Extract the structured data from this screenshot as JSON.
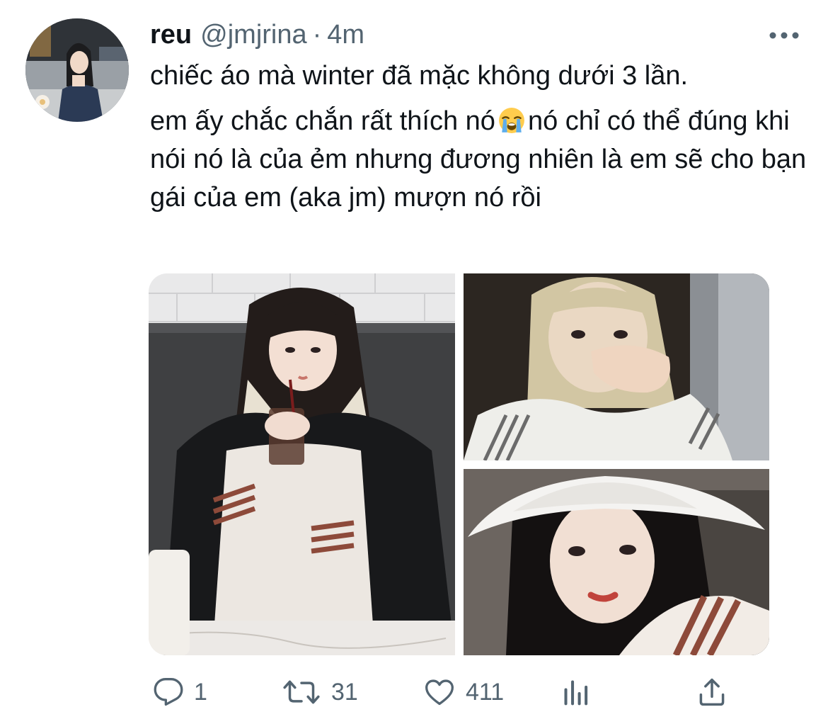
{
  "tweet": {
    "author": {
      "display_name": "reu",
      "handle": "@jmjrina",
      "avatar_icon": "profile-photo"
    },
    "separator": "·",
    "time": "4m",
    "more_icon": "more-horizontal-icon",
    "text_lines": [
      "chiếc áo mà winter đã mặc không dưới 3 lần.",
      "em ấy chắc chắn rất thích nó",
      "nó chỉ có thể đúng khi nói nó là của ẻm nhưng đương nhiên là em sẽ cho bạn gái của em (aka jm) mượn nó rồi"
    ],
    "emoji": "loudly-crying-face",
    "media": [
      {
        "name": "photo-girl-with-drink"
      },
      {
        "name": "photo-girl-covering-mouth"
      },
      {
        "name": "photo-girl-bucket-hat"
      }
    ],
    "actions": {
      "replies": "1",
      "retweets": "31",
      "likes": "411",
      "reply_icon": "reply-icon",
      "retweet_icon": "retweet-icon",
      "like_icon": "heart-icon",
      "analytics_icon": "analytics-icon",
      "share_icon": "share-icon"
    }
  },
  "colors": {
    "text_primary": "#0f1419",
    "text_secondary": "#536471",
    "background": "#ffffff"
  }
}
